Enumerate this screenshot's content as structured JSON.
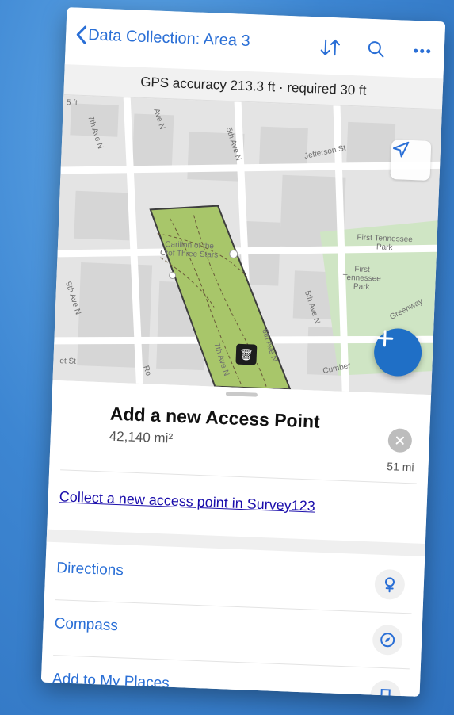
{
  "nav": {
    "back_title": "Data Collection: Area 3"
  },
  "gps": {
    "text": "GPS accuracy 213.3 ft · required 30 ft"
  },
  "map": {
    "labels": {
      "seventh_ave_n_1": "7th Ave N",
      "fifth_ave_n_1": "5th Ave N",
      "ave_n": "Ave N",
      "jefferson_st": "Jefferson St",
      "first_tennessee_park_1": "First Tennessee Park",
      "first_tennessee_park_2": "First Tennessee Park",
      "carillon": "Carillon of the Ctof Three Stars",
      "ninth_ave_n": "9th Ave N",
      "fifth_ave_n_2": "5th Ave N",
      "sixth_ave_n": "6th Ave N",
      "seventh_ave_n_2": "7th Ave N",
      "et_st": "et St",
      "cumberland": "Cumber",
      "greenway": "Greenway",
      "five_ft": "5 ft",
      "road_r": "Ro"
    }
  },
  "sheet": {
    "title": "Add a new Access Point",
    "area": "42,140 mi²",
    "distance": "51 mi",
    "survey_link": "Collect a new access point in Survey123",
    "actions": [
      {
        "label": "Directions",
        "icon": "directions-icon"
      },
      {
        "label": "Compass",
        "icon": "compass-icon"
      },
      {
        "label": "Add to My Places",
        "icon": "bookmark-icon"
      }
    ]
  },
  "colors": {
    "accent": "#2a6fd6",
    "fab": "#1f6fc6",
    "park_polygon": "#a8c66a",
    "park_green": "#cfe5c4",
    "link": "#1a0dab"
  }
}
